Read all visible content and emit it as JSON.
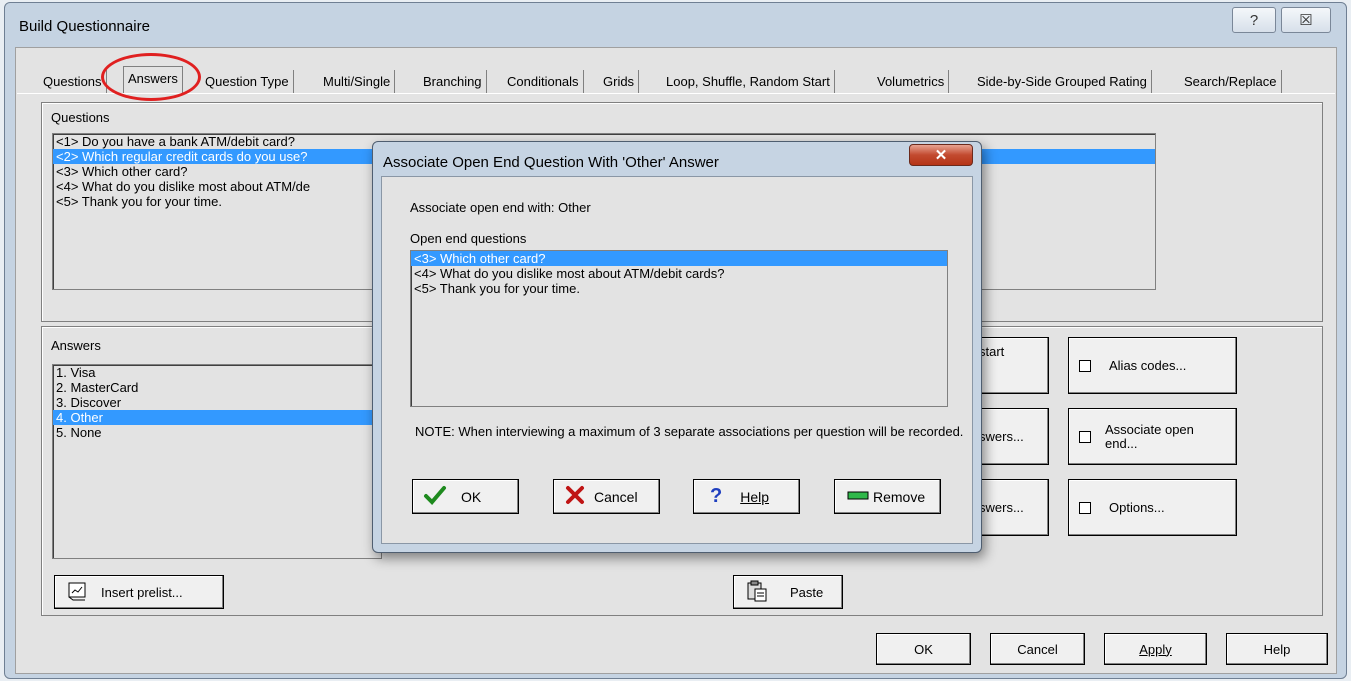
{
  "window": {
    "title": "Build Questionnaire",
    "help_glyph": "?",
    "close_glyph": "☒"
  },
  "tabs": [
    "Questions",
    "Answers",
    "Question Type",
    "Multi/Single",
    "Branching",
    "Conditionals",
    "Grids",
    "Loop, Shuffle, Random Start",
    "Volumetrics",
    "Side-by-Side Grouped Rating",
    "Search/Replace"
  ],
  "questions_group": {
    "label": "Questions",
    "items": [
      "<1>  Do you have a bank ATM/debit card?",
      "<2>  Which regular credit cards do you use?",
      "<3>  Which other card?",
      "<4>  What do you dislike most about ATM/de",
      "<5>  Thank you for your time."
    ],
    "selected_index": 1
  },
  "answers_group": {
    "label": "Answers",
    "items": [
      "1. Visa",
      "2. MasterCard",
      "3. Discover",
      "4. Other",
      "5. None"
    ],
    "selected_index": 3
  },
  "buttons": {
    "insert_prelist": "Insert prelist...",
    "paste": "Paste",
    "start_partial": "start",
    "answers1_partial": "swers...",
    "answers2_partial": "swers...",
    "alias_codes": "Alias codes...",
    "associate_open_end": "Associate open end...",
    "options": "Options...",
    "ok": "OK",
    "cancel": "Cancel",
    "apply": "Apply",
    "help": "Help"
  },
  "dialog": {
    "title": "Associate Open End Question With 'Other' Answer",
    "close_glyph": "✕",
    "associate_text": "Associate open end with: Other",
    "list_label": "Open end questions",
    "items": [
      "<3>  Which other card?",
      "<4>  What do you dislike most about ATM/debit cards?",
      "<5>  Thank you for your time."
    ],
    "selected_index": 0,
    "note": "NOTE: When interviewing a maximum of 3 separate associations per question will be recorded.",
    "ok": "OK",
    "cancel": "Cancel",
    "help": "Help",
    "remove": "Remove"
  },
  "colors": {
    "selection": "#3399ff",
    "annotation": "#e02020"
  }
}
